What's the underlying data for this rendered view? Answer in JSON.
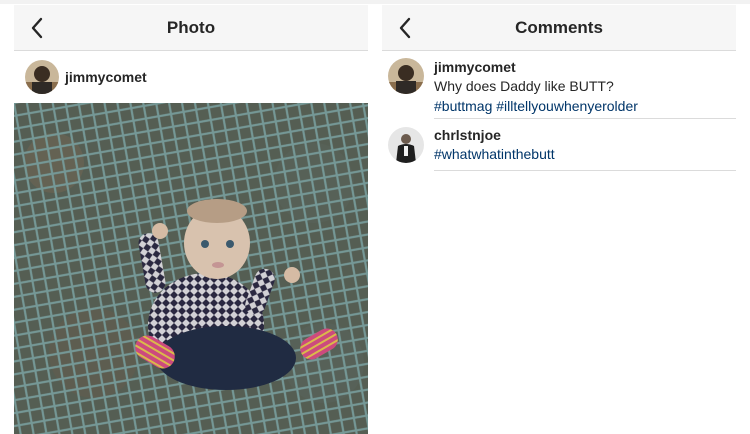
{
  "left_panel": {
    "title": "Photo",
    "post_user": "jimmycomet"
  },
  "right_panel": {
    "title": "Comments",
    "comments": [
      {
        "user": "jimmycomet",
        "text": "Why does Daddy like BUTT?",
        "tags": "#buttmag #illtellyouwhenyerolder"
      },
      {
        "user": "chrlstnjoe",
        "tags": "#whatwhatinthebutt"
      }
    ]
  },
  "colors": {
    "nav_bg": "#f6f6f6",
    "divider": "#dbdbdb",
    "hashtag": "#003569"
  },
  "icons": [
    "chevron-left-icon",
    "chevron-left-icon"
  ]
}
